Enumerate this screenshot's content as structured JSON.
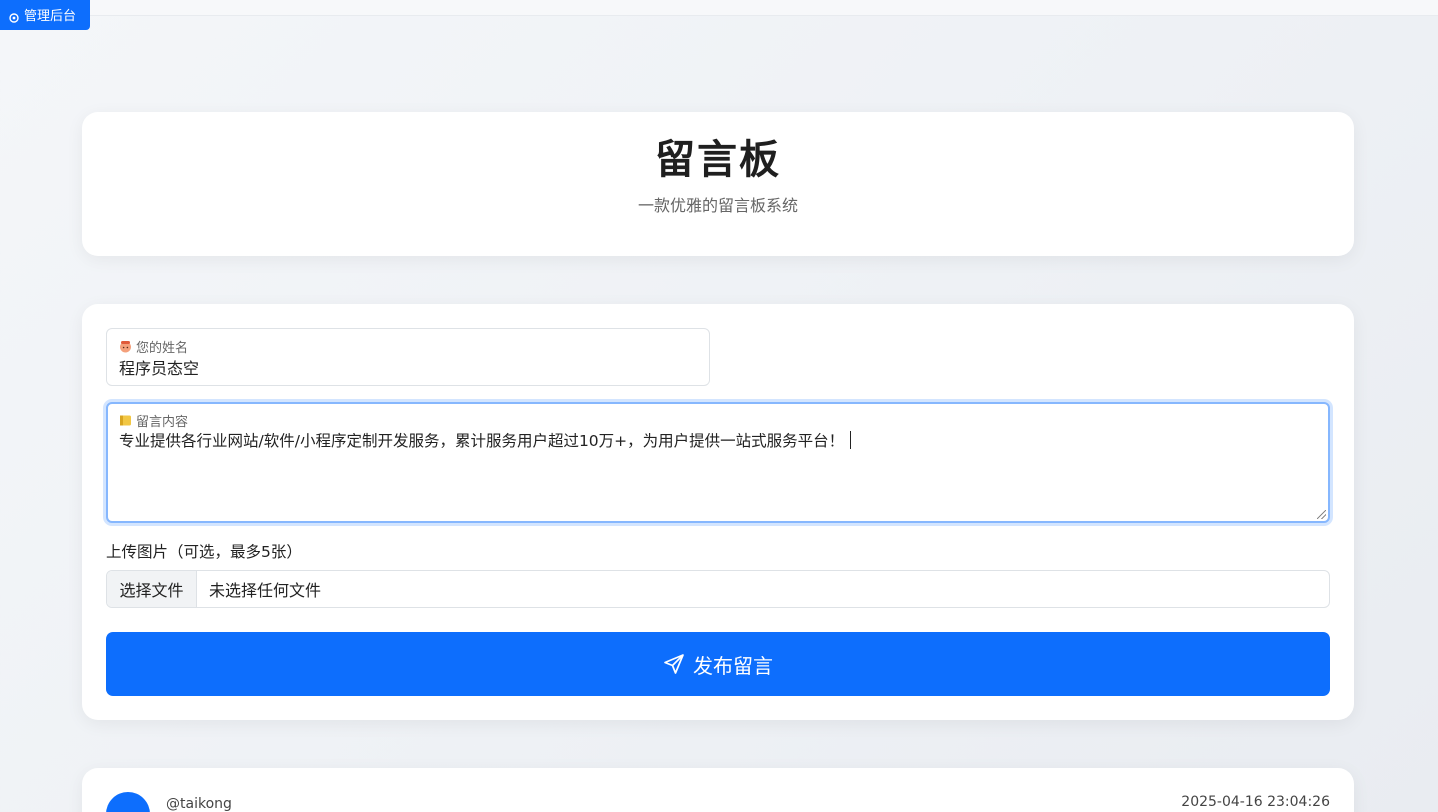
{
  "admin": {
    "label": "管理后台",
    "icon": "gear-icon"
  },
  "header": {
    "title": "留言板",
    "subtitle": "一款优雅的留言板系统"
  },
  "form": {
    "name_label": "您的姓名",
    "name_icon": "face-emoji-icon",
    "name_value": "程序员态空",
    "content_label": "留言内容",
    "content_icon": "note-emoji-icon",
    "content_value": "专业提供各行业网站/软件/小程序定制开发服务，累计服务用户超过10万+，为用户提供一站式服务平台！",
    "upload_label": "上传图片（可选，最多5张）",
    "file_button": "选择文件",
    "file_status": "未选择任何文件",
    "submit_label": "发布留言",
    "submit_icon": "send-icon"
  },
  "messages": [
    {
      "user": "@taikong",
      "time": "2025-04-16 23:04:26"
    }
  ],
  "colors": {
    "primary": "#0d6efd",
    "focus_border": "#86b7fe",
    "background": "#eef1f5"
  }
}
